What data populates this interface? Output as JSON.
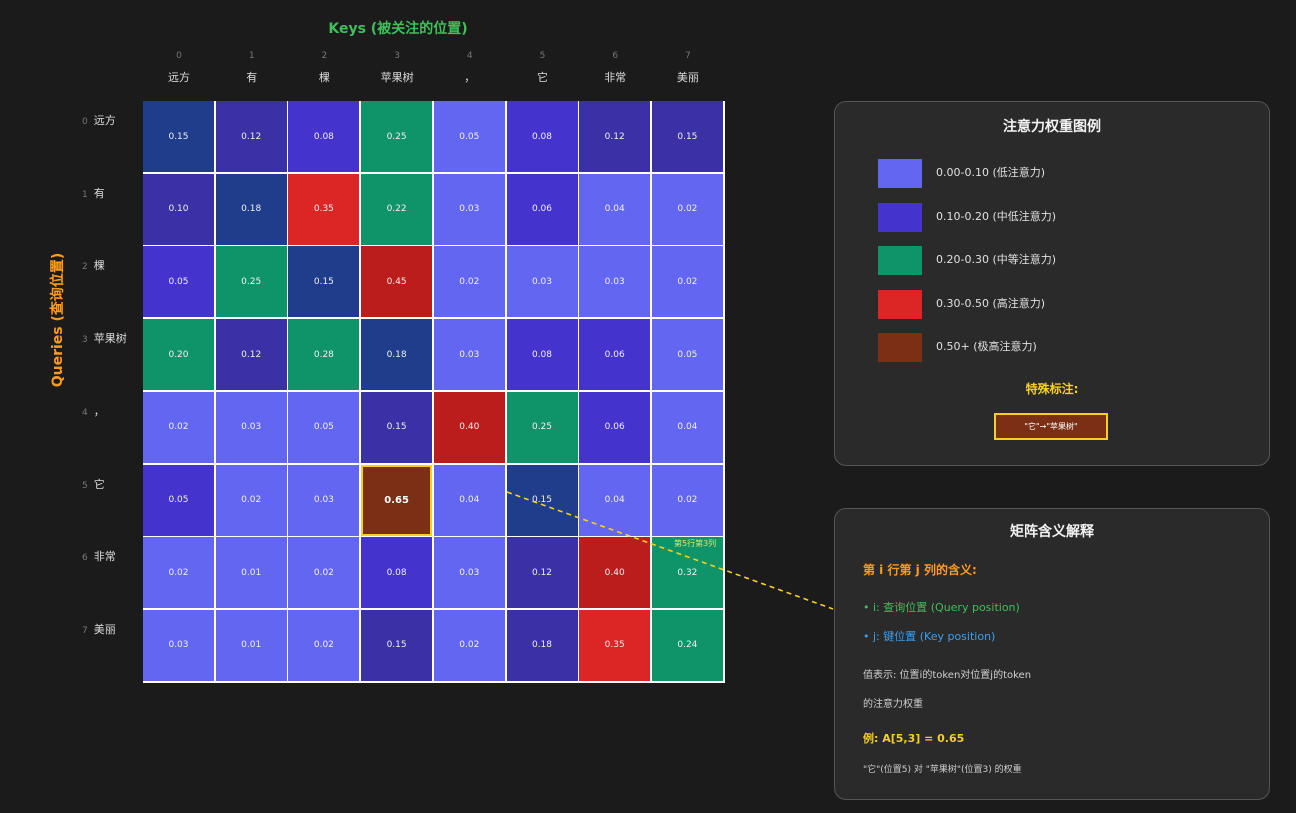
{
  "axes": {
    "keys_title": "Keys (被关注的位置)",
    "queries_title": "Queries (查询位置)"
  },
  "tokens": [
    "远方",
    "有",
    "棵",
    "苹果树",
    "，",
    "它",
    "非常",
    "美丽"
  ],
  "indices": [
    "0",
    "1",
    "2",
    "3",
    "4",
    "5",
    "6",
    "7"
  ],
  "matrix": [
    [
      "0.15",
      "0.12",
      "0.08",
      "0.25",
      "0.05",
      "0.08",
      "0.12",
      "0.15"
    ],
    [
      "0.10",
      "0.18",
      "0.35",
      "0.22",
      "0.03",
      "0.06",
      "0.04",
      "0.02"
    ],
    [
      "0.05",
      "0.25",
      "0.15",
      "0.45",
      "0.02",
      "0.03",
      "0.03",
      "0.02"
    ],
    [
      "0.20",
      "0.12",
      "0.28",
      "0.18",
      "0.03",
      "0.08",
      "0.06",
      "0.05"
    ],
    [
      "0.02",
      "0.03",
      "0.05",
      "0.15",
      "0.40",
      "0.25",
      "0.06",
      "0.04"
    ],
    [
      "0.05",
      "0.02",
      "0.03",
      "0.65",
      "0.04",
      "0.15",
      "0.04",
      "0.02"
    ],
    [
      "0.02",
      "0.01",
      "0.02",
      "0.08",
      "0.03",
      "0.12",
      "0.40",
      "0.32"
    ],
    [
      "0.03",
      "0.01",
      "0.02",
      "0.15",
      "0.02",
      "0.18",
      "0.35",
      "0.24"
    ]
  ],
  "cell_colors": [
    [
      "#1f3d8a",
      "#3a31a6",
      "#4433cc",
      "#0e9468",
      "#6366f1",
      "#4433cc",
      "#3a31a6",
      "#3a31a6"
    ],
    [
      "#3a31a6",
      "#1f3d8a",
      "#dc2626",
      "#0e9468",
      "#6366f1",
      "#4433cc",
      "#6366f1",
      "#6366f1"
    ],
    [
      "#4433cc",
      "#0e9468",
      "#1f3d8a",
      "#bb1c1c",
      "#6366f1",
      "#6366f1",
      "#6366f1",
      "#6366f1"
    ],
    [
      "#0e9468",
      "#3a31a6",
      "#0e9468",
      "#1f3d8a",
      "#6366f1",
      "#4433cc",
      "#4433cc",
      "#6366f1"
    ],
    [
      "#6366f1",
      "#6366f1",
      "#6366f1",
      "#3a31a6",
      "#bb1c1c",
      "#0e9468",
      "#4433cc",
      "#6366f1"
    ],
    [
      "#4433cc",
      "#6366f1",
      "#6366f1",
      "#7b2f15",
      "#6366f1",
      "#1f3d8a",
      "#6366f1",
      "#6366f1"
    ],
    [
      "#6366f1",
      "#6366f1",
      "#6366f1",
      "#4433cc",
      "#6366f1",
      "#3a31a6",
      "#bb1c1c",
      "#0e9468"
    ],
    [
      "#6366f1",
      "#6366f1",
      "#6366f1",
      "#3a31a6",
      "#6366f1",
      "#3a31a6",
      "#dc2626",
      "#0e9468"
    ]
  ],
  "highlight": {
    "row": 5,
    "col": 3,
    "label": "第5行第3列",
    "color": "#f5d020"
  },
  "legend": {
    "title": "注意力权重图例",
    "items": [
      {
        "label": "0.00-0.10 (低注意力)",
        "color": "#6366f1"
      },
      {
        "label": "0.10-0.20 (中低注意力)",
        "color": "#4433cc"
      },
      {
        "label": "0.20-0.30 (中等注意力)",
        "color": "#0e9468"
      },
      {
        "label": "0.30-0.50 (高注意力)",
        "color": "#dc2626"
      },
      {
        "label": "0.50+ (极高注意力)",
        "color": "#7b2f15"
      }
    ],
    "special_title": "特殊标注:",
    "special_box": "\"它\"→\"苹果树\""
  },
  "explanation": {
    "title": "矩阵含义解释",
    "heading": "第 i 行第 j 列的含义:",
    "bullet_i": "• i: 查询位置 (Query position)",
    "bullet_j": "• j: 键位置 (Key position)",
    "value_line1": "值表示: 位置i的token对位置j的token",
    "value_line2": "的注意力权重",
    "example": "例: A[5,3] = 0.65",
    "example_desc": "\"它\"(位置5) 对 \"苹果树\"(位置3) 的权重"
  }
}
